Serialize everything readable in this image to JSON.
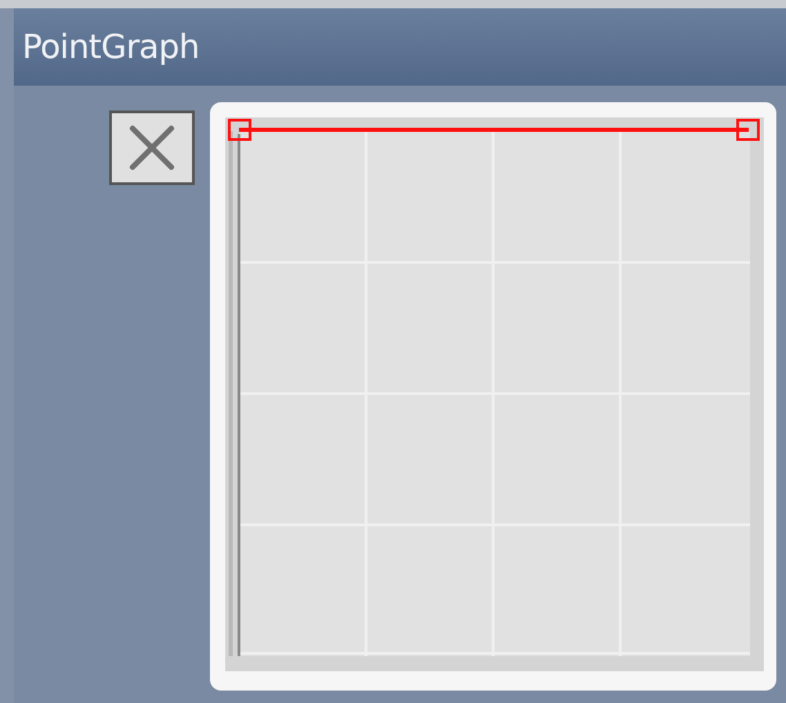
{
  "window": {
    "title": "PointGraph"
  }
}
